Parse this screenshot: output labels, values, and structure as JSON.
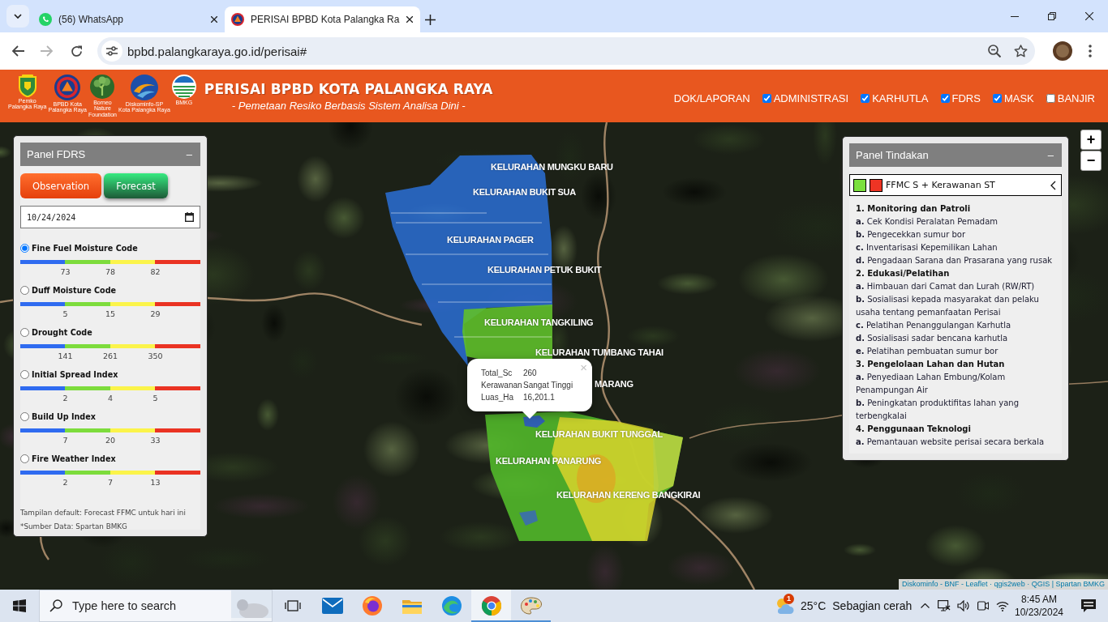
{
  "browser": {
    "tabs": [
      {
        "title": "(56) WhatsApp",
        "kind": "chat",
        "selected": false
      },
      {
        "title": "PERISAI BPBD Kota Palangka Ra",
        "kind": "site",
        "selected": true
      }
    ],
    "url": "bpbd.palangkaraya.go.id/perisai#",
    "forward_disabled": true
  },
  "header": {
    "logos": [
      {
        "kind": "shield",
        "caption": "Pemko\nPalangka Raya"
      },
      {
        "kind": "disc",
        "caption": "BPBD Kota\nPalangka Raya"
      },
      {
        "kind": "tree",
        "caption": "Borneo\nNature\nFoundation"
      },
      {
        "kind": "swirl",
        "caption": "Diskominfo-SP\nKota Palangka Raya"
      },
      {
        "kind": "waves",
        "caption": "BMKG"
      }
    ],
    "title": "PERISAI BPBD KOTA PALANGKA RAYA",
    "subtitle": "- Pemetaan Resiko Berbasis Sistem Analisa Dini -",
    "nav": [
      {
        "label": "DOK/LAPORAN",
        "kind": "link"
      },
      {
        "label": "ADMINISTRASI",
        "kind": "checkbox",
        "checked": true
      },
      {
        "label": "KARHUTLA",
        "kind": "checkbox",
        "checked": true
      },
      {
        "label": "FDRS",
        "kind": "checkbox",
        "checked": true
      },
      {
        "label": "MASK",
        "kind": "checkbox",
        "checked": true
      },
      {
        "label": "BANJIR",
        "kind": "checkbox",
        "checked": false
      }
    ]
  },
  "fdrs_panel": {
    "title": "Panel FDRS",
    "collapse": "–",
    "modes": [
      {
        "label": "Observation",
        "kind": "observation"
      },
      {
        "label": "Forecast",
        "kind": "forecast"
      }
    ],
    "date": "10/24/2024",
    "indices": [
      {
        "label": "Fine Fuel Moisture Code",
        "selected": true,
        "thresholds": [
          "73",
          "78",
          "82"
        ]
      },
      {
        "label": "Duff Moisture Code",
        "selected": false,
        "thresholds": [
          "5",
          "15",
          "29"
        ]
      },
      {
        "label": "Drought Code",
        "selected": false,
        "thresholds": [
          "141",
          "261",
          "350"
        ]
      },
      {
        "label": "Initial Spread Index",
        "selected": false,
        "thresholds": [
          "2",
          "4",
          "5"
        ]
      },
      {
        "label": "Build Up Index",
        "selected": false,
        "thresholds": [
          "7",
          "20",
          "33"
        ]
      },
      {
        "label": "Fire Weather Index",
        "selected": false,
        "thresholds": [
          "2",
          "7",
          "13"
        ]
      }
    ],
    "notes": [
      "Tampilan default: Forecast FFMC untuk hari ini",
      "*Sumber Data: Spartan BMKG"
    ]
  },
  "action_panel": {
    "title": "Panel Tindakan",
    "collapse": "–",
    "legend": {
      "swatches": [
        {
          "color": "#7be03e"
        },
        {
          "color": "#ee3424"
        }
      ],
      "label": "FFMC S + Kerawanan ST"
    },
    "sections": [
      {
        "heading": "1. Monitoring dan Patroli",
        "items": [
          "**a.** Cek Kondisi Peralatan Pemadam",
          "**b.** Pengecekkan sumur bor",
          "**c.** Inventarisasi Kepemilikan Lahan",
          "**d.** Pengadaan Sarana dan Prasarana yang rusak"
        ]
      },
      {
        "heading": "2. Edukasi/Pelatihan",
        "items": [
          "**a.** Himbauan dari Camat dan Lurah (RW/RT)",
          "**b.** Sosialisasi kepada masyarakat dan pelaku usaha tentang pemanfaatan Perisai",
          "**c.** Pelatihan Penanggulangan Karhutla",
          "**d.** Sosialisasi sadar bencana karhutla",
          "**e.** Pelatihan pembuatan sumur bor"
        ]
      },
      {
        "heading": "3. Pengelolaan Lahan dan Hutan",
        "items": [
          "**a.** Penyediaan Lahan Embung/Kolam Penampungan Air",
          "**b.** Peningkatan produktifitas lahan yang terbengkalai"
        ]
      },
      {
        "heading": "4. Penggunaan Teknologi",
        "items": [
          "**a.** Pemantauan website perisai secara berkala"
        ]
      }
    ]
  },
  "map": {
    "zoom": {
      "in": "+",
      "out": "−"
    },
    "labels": [
      "KELURAHAN MUNGKU BARU",
      "KELURAHAN BUKIT SUA",
      "KELURAHAN PAGER",
      "KELURAHAN PETUK BUKIT",
      "KELURAHAN TANGKILING",
      "KELURAHAN TUMBANG TAHAI",
      "MARANG",
      "KELURAHAN BUKIT TUNGGAL",
      "KELURAHAN PANARUNG",
      "KELURAHAN KERENG BANGKIRAI"
    ],
    "popup": {
      "close": "×",
      "rows": [
        {
          "key": "Total_Sc",
          "value": "260"
        },
        {
          "key": "Kerawanan",
          "value": "Sangat Tinggi"
        },
        {
          "key": "Luas_Ha",
          "value": "16,201.1"
        }
      ]
    },
    "attribution": "Diskominfo - BNF - Leaflet · qgis2web · QGIS | Spartan BMKG"
  },
  "taskbar": {
    "search_placeholder": "Type here to search",
    "apps": [
      {
        "kind": "task-view",
        "running": false,
        "active": false
      },
      {
        "kind": "mail",
        "running": false,
        "active": false
      },
      {
        "kind": "firefox",
        "running": false,
        "active": false
      },
      {
        "kind": "files",
        "running": false,
        "active": false
      },
      {
        "kind": "edge",
        "running": false,
        "active": false
      },
      {
        "kind": "chrome",
        "running": true,
        "active": true
      },
      {
        "kind": "paint",
        "running": true,
        "active": false
      }
    ],
    "weather": {
      "badge": "1",
      "temperature": "25°C",
      "condition": "Sebagian cerah"
    },
    "clock": {
      "time": "8:45 AM",
      "date": "10/23/2024"
    }
  }
}
